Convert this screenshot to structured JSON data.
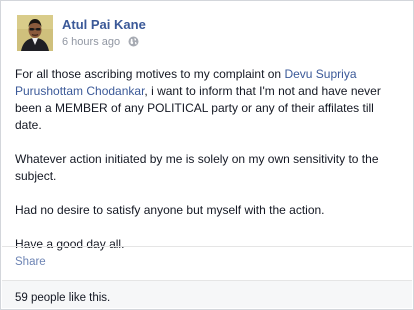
{
  "post": {
    "author": "Atul Pai Kane",
    "time": "6 hours ago",
    "paragraph1_before_link": "For all those ascribing motives to my complaint on ",
    "paragraph1_link": "Devu Supriya Purushottam Chodankar",
    "paragraph1_after_link": ", i want to inform that I'm not and have never been a MEMBER of any POLITICAL party or any of their affilates till date.",
    "paragraph2": "Whatever action initiated by me is solely on my own sensitivity to the subject.",
    "paragraph3": "Had no desire to satisfy anyone but myself with the action.",
    "paragraph4": "Have a good day all."
  },
  "actions": {
    "share": "Share"
  },
  "likes": {
    "text": "59 people like this."
  },
  "icons": {
    "privacy": "globe-icon"
  },
  "colors": {
    "link": "#3b5998",
    "meta": "#9197a3",
    "action": "#6d84b4"
  }
}
